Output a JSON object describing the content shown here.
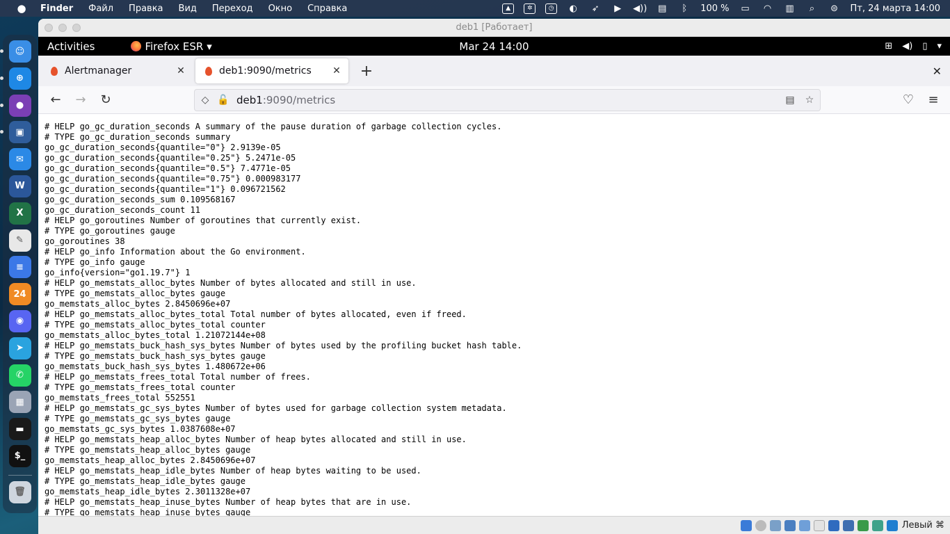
{
  "mac_menubar": {
    "app": "Finder",
    "menus": [
      "Файл",
      "Правка",
      "Вид",
      "Переход",
      "Окно",
      "Справка"
    ],
    "battery": "100 %",
    "datetime": "Пт, 24 марта  14:00"
  },
  "dock": {
    "apps": [
      {
        "name": "finder",
        "color": "#3a8ee6",
        "glyph": "☺"
      },
      {
        "name": "safari",
        "color": "#1e88e5",
        "glyph": "⊕"
      },
      {
        "name": "firefox",
        "color": "#7b3fb5",
        "glyph": "●"
      },
      {
        "name": "virtualbox",
        "color": "#2f5d9b",
        "glyph": "▣"
      },
      {
        "name": "mail",
        "color": "#2b89e6",
        "glyph": "✉"
      },
      {
        "name": "word",
        "color": "#2b579a",
        "glyph": "W"
      },
      {
        "name": "excel",
        "color": "#217346",
        "glyph": "X"
      },
      {
        "name": "textedit",
        "color": "#e8e8e8",
        "glyph": "✎"
      },
      {
        "name": "docs",
        "color": "#3b78e7",
        "glyph": "≡"
      },
      {
        "name": "calendar-24",
        "color": "#f08a24",
        "glyph": "24"
      },
      {
        "name": "discord",
        "color": "#5865f2",
        "glyph": "◉"
      },
      {
        "name": "telegram",
        "color": "#2aa3df",
        "glyph": "➤"
      },
      {
        "name": "whatsapp",
        "color": "#25d366",
        "glyph": "✆"
      },
      {
        "name": "launchpad",
        "color": "#9aa4b5",
        "glyph": "▦"
      },
      {
        "name": "screenshot",
        "color": "#1a1a1a",
        "glyph": "▬"
      },
      {
        "name": "terminal",
        "color": "#111111",
        "glyph": "$_"
      }
    ],
    "trash": {
      "name": "trash",
      "color": "#cfd6de",
      "glyph": "🗑"
    }
  },
  "vbox": {
    "title": "deb1 [Работает]",
    "hostkey": "Левый ⌘"
  },
  "gnome": {
    "activities": "Activities",
    "app_name": "Firefox ESR",
    "clock": "Mar 24  14:00"
  },
  "firefox": {
    "tabs": [
      {
        "label": "Alertmanager",
        "active": false
      },
      {
        "label": "deb1:9090/metrics",
        "active": true
      }
    ],
    "url_host": "deb1",
    "url_path": ":9090/metrics"
  },
  "metrics": [
    "# HELP go_gc_duration_seconds A summary of the pause duration of garbage collection cycles.",
    "# TYPE go_gc_duration_seconds summary",
    "go_gc_duration_seconds{quantile=\"0\"} 2.9139e-05",
    "go_gc_duration_seconds{quantile=\"0.25\"} 5.2471e-05",
    "go_gc_duration_seconds{quantile=\"0.5\"} 7.4771e-05",
    "go_gc_duration_seconds{quantile=\"0.75\"} 0.000983177",
    "go_gc_duration_seconds{quantile=\"1\"} 0.096721562",
    "go_gc_duration_seconds_sum 0.109568167",
    "go_gc_duration_seconds_count 11",
    "# HELP go_goroutines Number of goroutines that currently exist.",
    "# TYPE go_goroutines gauge",
    "go_goroutines 38",
    "# HELP go_info Information about the Go environment.",
    "# TYPE go_info gauge",
    "go_info{version=\"go1.19.7\"} 1",
    "# HELP go_memstats_alloc_bytes Number of bytes allocated and still in use.",
    "# TYPE go_memstats_alloc_bytes gauge",
    "go_memstats_alloc_bytes 2.8450696e+07",
    "# HELP go_memstats_alloc_bytes_total Total number of bytes allocated, even if freed.",
    "# TYPE go_memstats_alloc_bytes_total counter",
    "go_memstats_alloc_bytes_total 1.21072144e+08",
    "# HELP go_memstats_buck_hash_sys_bytes Number of bytes used by the profiling bucket hash table.",
    "# TYPE go_memstats_buck_hash_sys_bytes gauge",
    "go_memstats_buck_hash_sys_bytes 1.480672e+06",
    "# HELP go_memstats_frees_total Total number of frees.",
    "# TYPE go_memstats_frees_total counter",
    "go_memstats_frees_total 552551",
    "# HELP go_memstats_gc_sys_bytes Number of bytes used for garbage collection system metadata.",
    "# TYPE go_memstats_gc_sys_bytes gauge",
    "go_memstats_gc_sys_bytes 1.0387608e+07",
    "# HELP go_memstats_heap_alloc_bytes Number of heap bytes allocated and still in use.",
    "# TYPE go_memstats_heap_alloc_bytes gauge",
    "go_memstats_heap_alloc_bytes 2.8450696e+07",
    "# HELP go_memstats_heap_idle_bytes Number of heap bytes waiting to be used.",
    "# TYPE go_memstats_heap_idle_bytes gauge",
    "go_memstats_heap_idle_bytes 2.3011328e+07",
    "# HELP go_memstats_heap_inuse_bytes Number of heap bytes that are in use.",
    "# TYPE go_memstats_heap_inuse_bytes gauge"
  ]
}
